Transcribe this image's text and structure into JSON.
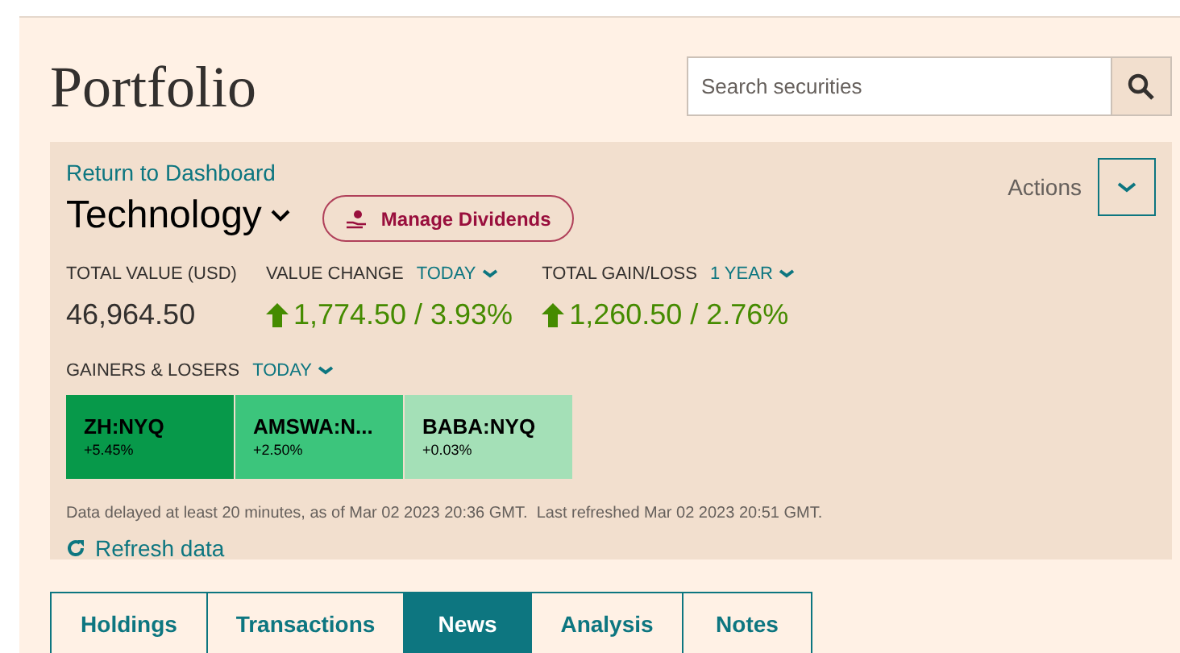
{
  "title": "Portfolio",
  "search": {
    "placeholder": "Search securities"
  },
  "panel": {
    "back_link": "Return to Dashboard",
    "portfolio_name": "Technology",
    "dividends_button": "Manage Dividends",
    "actions_label": "Actions",
    "stats": [
      {
        "label": "TOTAL VALUE (USD)",
        "value": "46,964.50",
        "kind": "plain"
      },
      {
        "label": "VALUE CHANGE",
        "period": "TODAY",
        "value": "1,774.50 / 3.93%",
        "kind": "up"
      },
      {
        "label": "TOTAL GAIN/LOSS",
        "period": "1 YEAR",
        "value": "1,260.50 / 2.76%",
        "kind": "up"
      }
    ],
    "movers_label": "GAINERS & LOSERS",
    "movers_period": "TODAY",
    "movers": [
      {
        "symbol": "ZH:NYQ",
        "change": "+5.45%",
        "color": "#07994a"
      },
      {
        "symbol": "AMSWA:N...",
        "change": "+2.50%",
        "color": "#3cc57c"
      },
      {
        "symbol": "BABA:NYQ",
        "change": "+0.03%",
        "color": "#a4e0b7"
      }
    ],
    "disclaimer": "Data delayed at least 20 minutes, as of Mar 02 2023 20:36 GMT.  Last refreshed Mar 02 2023 20:51 GMT.",
    "refresh": "Refresh data"
  },
  "tabs": [
    {
      "label": "Holdings",
      "selected": false
    },
    {
      "label": "Transactions",
      "selected": false
    },
    {
      "label": "News",
      "selected": true
    },
    {
      "label": "Analysis",
      "selected": false
    },
    {
      "label": "Notes",
      "selected": false
    }
  ]
}
